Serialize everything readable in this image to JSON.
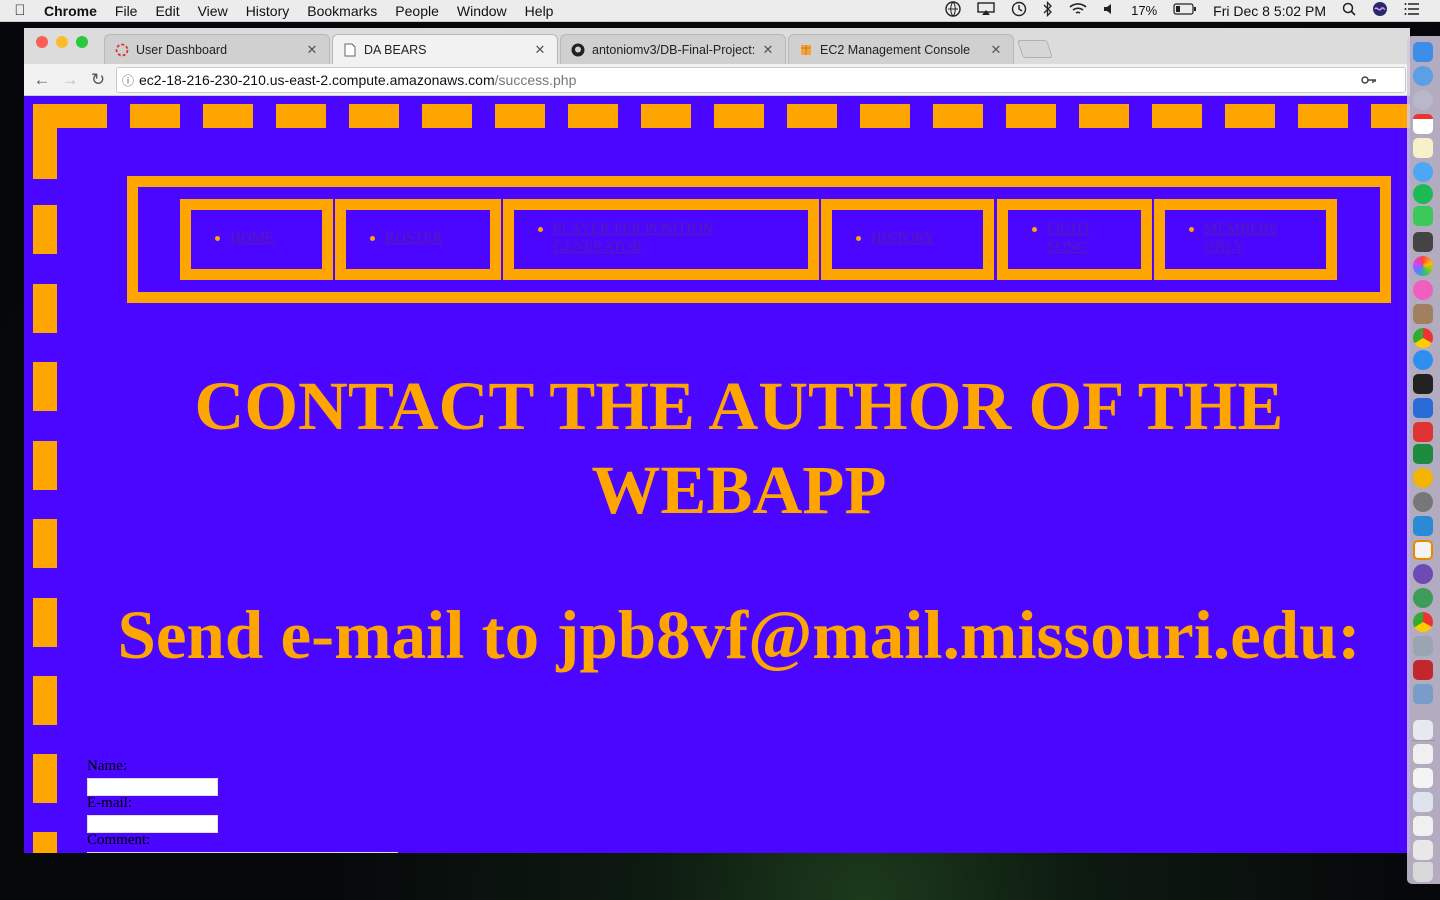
{
  "menubar": {
    "app_name": "Chrome",
    "menus": [
      "File",
      "Edit",
      "View",
      "History",
      "Bookmarks",
      "People",
      "Window",
      "Help"
    ],
    "battery": "17%",
    "clock": "Fri Dec 8  5:02 PM"
  },
  "browser": {
    "tabs": [
      {
        "label": "User Dashboard",
        "icon": "loading-icon",
        "active": false
      },
      {
        "label": "DA BEARS",
        "icon": "document-icon",
        "active": true
      },
      {
        "label": "antoniomv3/DB-Final-Project:",
        "icon": "github-icon",
        "active": false
      },
      {
        "label": "EC2 Management Console",
        "icon": "aws-cube-icon",
        "active": false
      }
    ],
    "url_host": "ec2-18-216-230-210.us-east-2.compute.amazonaws.com",
    "url_path": "/success.php"
  },
  "page": {
    "nav": [
      {
        "label": "HOME"
      },
      {
        "label": "ROSTER"
      },
      {
        "label": "PLAYER PER POSITION GENERATOR"
      },
      {
        "label": "HISTORY"
      },
      {
        "label": "FIGHT SONG"
      },
      {
        "label": "MEMBERS ONLY"
      }
    ],
    "heading": "CONTACT THE AUTHOR OF THE WEBAPP",
    "email_heading": "Send e-mail to jpb8vf@mail.missouri.edu:",
    "form": {
      "name_label": "Name:",
      "email_label": "E-mail:",
      "comment_label": "Comment:"
    },
    "colors": {
      "background": "#4a06ff",
      "accent": "#ffa500",
      "link": "#5a1ab0"
    }
  }
}
